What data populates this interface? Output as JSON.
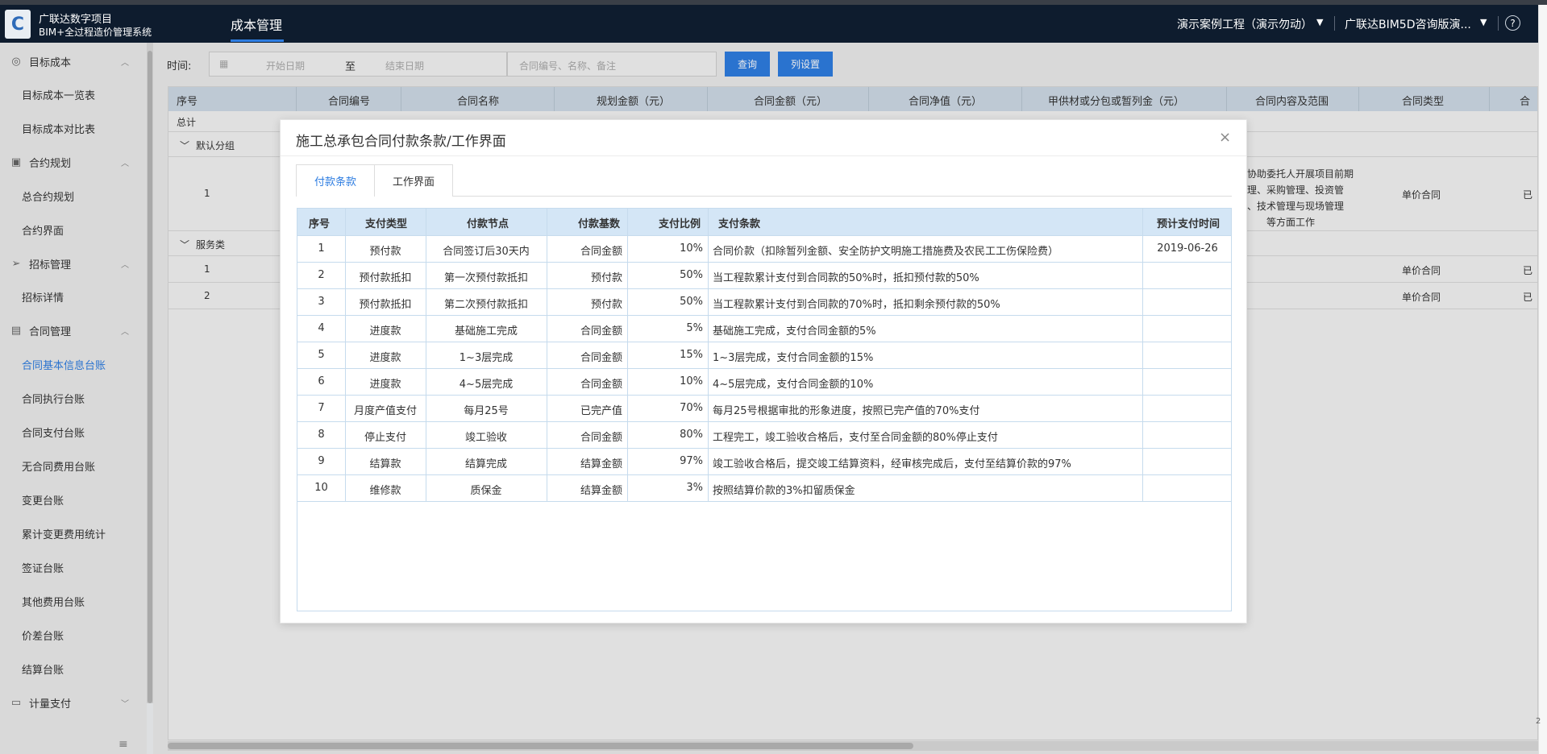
{
  "header": {
    "brand_line1": "广联达数字项目",
    "brand_line2": "BIM+全过程造价管理系统",
    "logo_glyph": "C",
    "nav_title": "成本管理",
    "project": "演示案例工程（演示勿动）",
    "company": "广联达BIM5D咨询版演...",
    "help": "?"
  },
  "sidebar": {
    "groups": [
      {
        "icon": "database-icon",
        "label": "目标成本",
        "items": [
          "目标成本一览表",
          "目标成本对比表"
        ]
      },
      {
        "icon": "document-icon",
        "label": "合约规划",
        "items": [
          "总合约规划",
          "合约界面"
        ]
      },
      {
        "icon": "send-icon",
        "label": "招标管理",
        "items": [
          "招标详情"
        ]
      },
      {
        "icon": "briefcase-icon",
        "label": "合同管理",
        "items": [
          "合同基本信息台账",
          "合同执行台账",
          "合同支付台账",
          "无合同费用台账",
          "变更台账",
          "累计变更费用统计",
          "签证台账",
          "其他费用台账",
          "价差台账",
          "结算台账"
        ]
      },
      {
        "icon": "wallet-icon",
        "label": "计量支付",
        "items": []
      }
    ],
    "active_item": "合同基本信息台账",
    "collapse_icon": "≡"
  },
  "filters": {
    "time_label": "时间:",
    "start_placeholder": "开始日期",
    "to_label": "至",
    "end_placeholder": "结束日期",
    "keyword_placeholder": "合同编号、名称、备注",
    "query_button": "查询",
    "columns_button": "列设置"
  },
  "bg_table": {
    "columns": [
      "序号",
      "合同编号",
      "合同名称",
      "规划金额（元）",
      "合同金额（元）",
      "合同净值（元）",
      "甲供材或分包或暂列金（元）",
      "合同内容及范围",
      "合同类型",
      "合"
    ],
    "total_label": "总计",
    "group1": "默认分组",
    "group2": "服务类",
    "row1_index": "1",
    "row1_scope": [
      "协助委托人开展项目前期",
      "理、采购管理、投资管",
      "、技术管理与现场管理",
      "等方面工作"
    ],
    "row1_type": "单价合同",
    "row1_status": "已",
    "row2_index": "1",
    "row2_type": "单价合同",
    "row2_status": "已",
    "row3_index": "2",
    "row3_type": "单价合同",
    "row3_status": "已"
  },
  "modal": {
    "title": "施工总承包合同付款条款/工作界面",
    "close": "×",
    "tabs": [
      "付款条款",
      "工作界面"
    ],
    "columns": [
      "序号",
      "支付类型",
      "付款节点",
      "付款基数",
      "支付比例",
      "支付条款",
      "预计支付时间"
    ],
    "rows": [
      [
        "1",
        "预付款",
        "合同签订后30天内",
        "合同金额",
        "10%",
        "合同价款（扣除暂列金额、安全防护文明施工措施费及农民工工伤保险费）",
        "2019-06-26"
      ],
      [
        "2",
        "预付款抵扣",
        "第一次预付款抵扣",
        "预付款",
        "50%",
        "当工程款累计支付到合同款的50%时，抵扣预付款的50%",
        ""
      ],
      [
        "3",
        "预付款抵扣",
        "第二次预付款抵扣",
        "预付款",
        "50%",
        "当工程款累计支付到合同款的70%时，抵扣剩余预付款的50%",
        ""
      ],
      [
        "4",
        "进度款",
        "基础施工完成",
        "合同金额",
        "5%",
        "基础施工完成，支付合同金额的5%",
        ""
      ],
      [
        "5",
        "进度款",
        "1~3层完成",
        "合同金额",
        "15%",
        "1~3层完成，支付合同金额的15%",
        ""
      ],
      [
        "6",
        "进度款",
        "4~5层完成",
        "合同金额",
        "10%",
        "4~5层完成，支付合同金额的10%",
        ""
      ],
      [
        "7",
        "月度产值支付",
        "每月25号",
        "已完产值",
        "70%",
        "每月25号根据审批的形象进度，按照已完产值的70%支付",
        ""
      ],
      [
        "8",
        "停止支付",
        "竣工验收",
        "合同金额",
        "80%",
        "工程完工，竣工验收合格后，支付至合同金额的80%停止支付",
        ""
      ],
      [
        "9",
        "结算款",
        "结算完成",
        "结算金额",
        "97%",
        "竣工验收合格后，提交竣工结算资料，经审核完成后，支付至结算价款的97%",
        ""
      ],
      [
        "10",
        "维修款",
        "质保金",
        "结算金额",
        "3%",
        "按照结算价款的3%扣留质保金",
        ""
      ]
    ]
  },
  "misc": {
    "corner_tag": "2"
  }
}
